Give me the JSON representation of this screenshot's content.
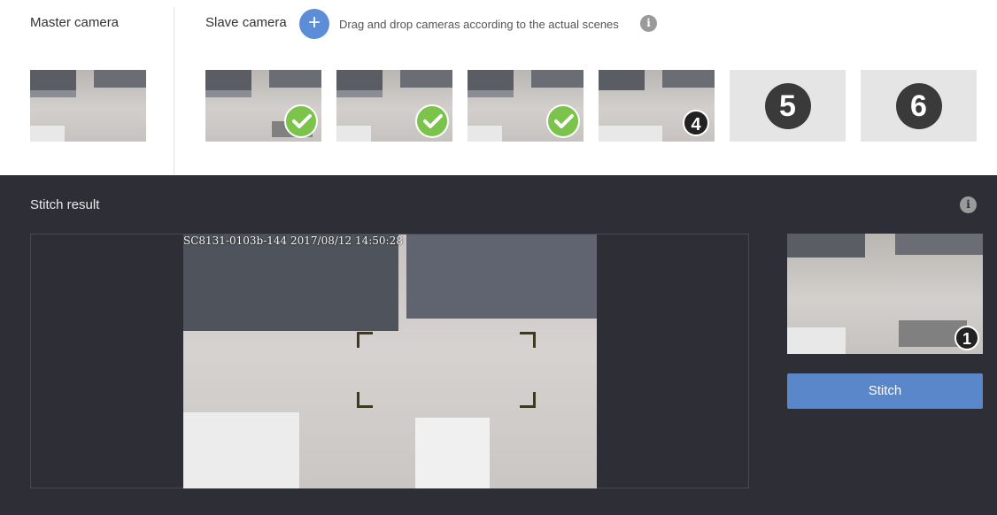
{
  "header": {
    "master_title": "Master camera",
    "slave_title": "Slave camera",
    "add_label": "+",
    "hint": "Drag and drop cameras according to the actual scenes",
    "info_icon": "i"
  },
  "slaves": [
    {
      "status": "checked"
    },
    {
      "status": "checked"
    },
    {
      "status": "checked"
    },
    {
      "status": "numbered",
      "number": "4"
    },
    {
      "status": "empty",
      "number": "5"
    },
    {
      "status": "empty",
      "number": "6"
    }
  ],
  "result": {
    "title": "Stitch result",
    "info_icon": "i",
    "overlay": "SC8131-0103b-144 2017/08/12 14:50:28",
    "preview_badge": "1",
    "stitch_label": "Stitch"
  },
  "colors": {
    "accent": "#5b8ed6",
    "check": "#7bc34a",
    "dark_panel": "#2e2f36"
  }
}
